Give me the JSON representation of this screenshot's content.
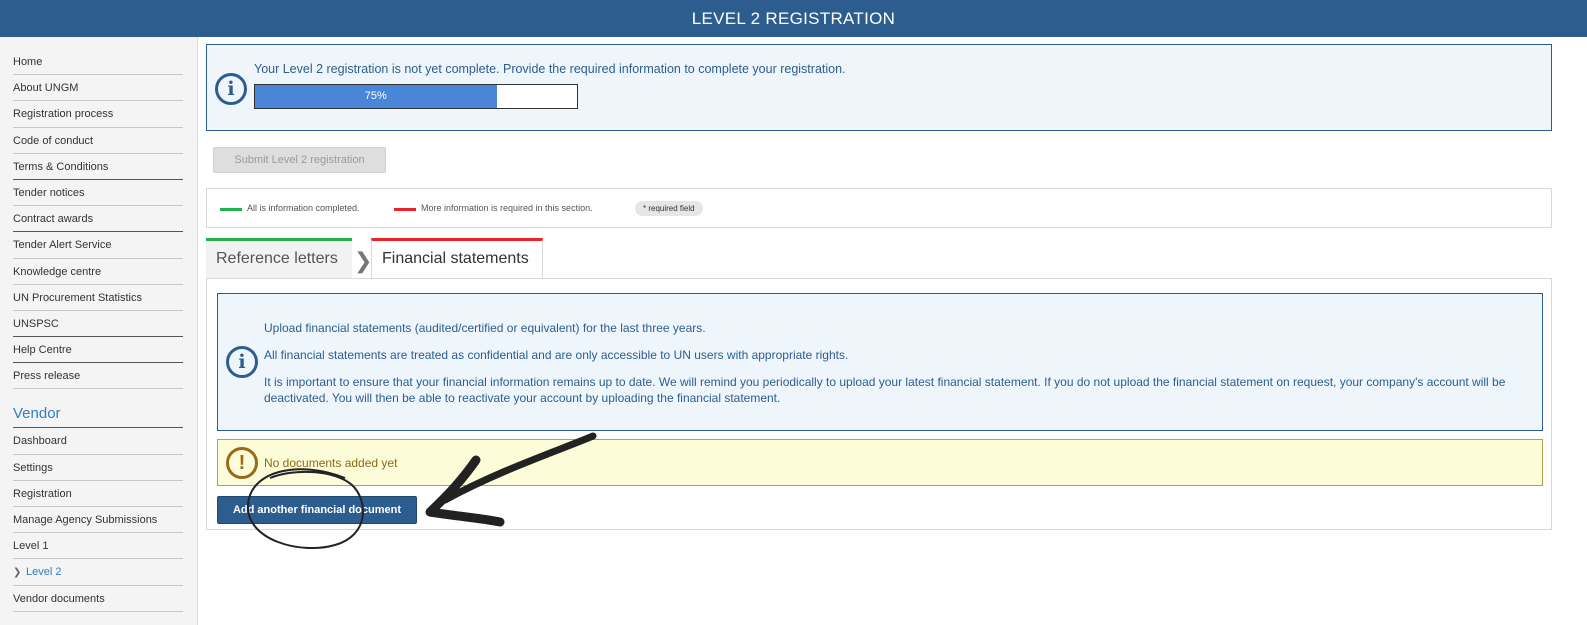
{
  "header": {
    "title": "LEVEL 2 REGISTRATION"
  },
  "sidebar": {
    "items": [
      {
        "label": "Home"
      },
      {
        "label": "About UNGM"
      },
      {
        "label": "Registration process"
      },
      {
        "label": "Code of conduct"
      },
      {
        "label": "Terms & Conditions"
      },
      {
        "label": "Tender notices"
      },
      {
        "label": "Contract awards"
      },
      {
        "label": "Tender Alert Service"
      },
      {
        "label": "Knowledge centre"
      },
      {
        "label": "UN Procurement Statistics"
      },
      {
        "label": "UNSPSC"
      },
      {
        "label": "Help Centre"
      },
      {
        "label": "Press release"
      }
    ],
    "vendor_heading": "Vendor",
    "vendor_items": [
      {
        "label": "Dashboard"
      },
      {
        "label": "Settings"
      },
      {
        "label": "Registration"
      },
      {
        "label": "Manage Agency Submissions"
      },
      {
        "label": "Level 1"
      },
      {
        "label": "Level 2",
        "active": true
      },
      {
        "label": "Vendor documents"
      }
    ]
  },
  "status": {
    "message": "Your Level 2 registration is not yet complete. Provide the required information to complete your registration.",
    "progress_value": 75,
    "progress_label": "75%"
  },
  "submit_label": "Submit Level 2 registration",
  "legend": {
    "complete_label": "All is information completed.",
    "incomplete_label": "More information is required in this section.",
    "required_label": "* required field",
    "complete_color": "#22b14c",
    "incomplete_color": "#e8232a"
  },
  "tabs": [
    {
      "label": "Reference letters",
      "status": "complete"
    },
    {
      "label": "Financial statements",
      "status": "incomplete",
      "active": true
    }
  ],
  "financial": {
    "info_lines": [
      "Upload financial statements (audited/certified or equivalent) for the last three years.",
      "All financial statements are treated as confidential and are only accessible to UN users with appropriate rights.",
      "It is important to ensure that your financial information remains up to date. We will remind you periodically to upload your latest financial statement. If you do not upload the financial statement on request, your company's account will be deactivated. You will then be able to reactivate your account by uploading the financial statement."
    ],
    "warning": "No documents added yet",
    "add_button": "Add another financial document"
  }
}
